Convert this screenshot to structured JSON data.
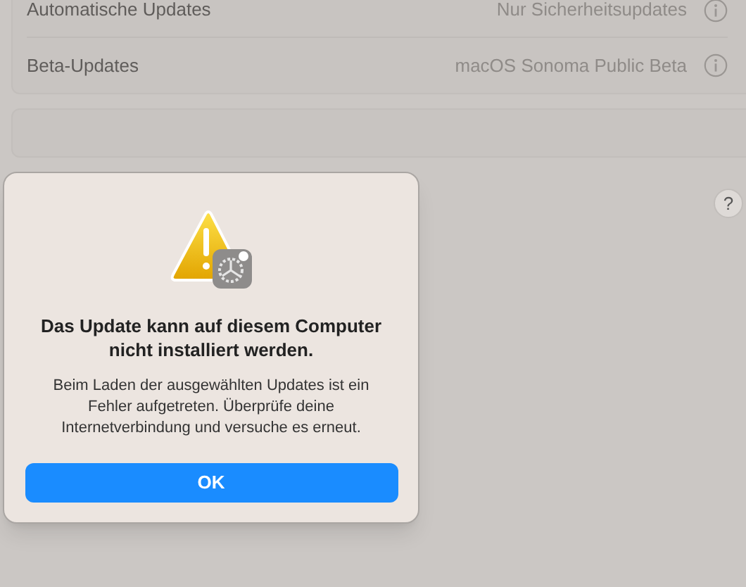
{
  "settings_rows": [
    {
      "label": "Automatische Updates",
      "value": "Nur Sicherheitsupdates"
    },
    {
      "label": "Beta-Updates",
      "value": "macOS Sonoma Public Beta"
    }
  ],
  "help_button": "?",
  "alert": {
    "title": "Das Update kann auf diesem Computer nicht installiert werden.",
    "message": "Beim Laden der ausgewählten Updates ist ein Fehler aufgetreten. Überprüfe deine Internetverbindung und versuche es erneut.",
    "button": "OK"
  }
}
